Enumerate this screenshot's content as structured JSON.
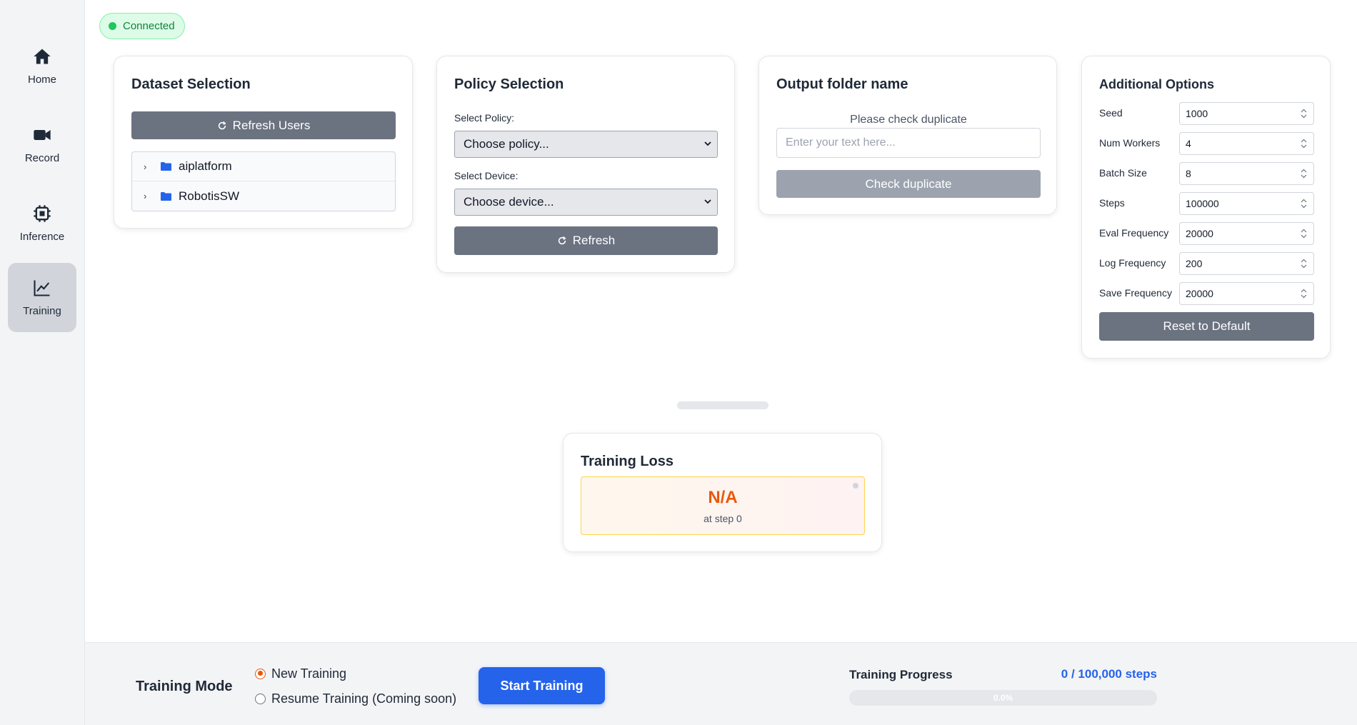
{
  "sidebar": {
    "items": [
      {
        "label": "Home",
        "icon": "home-icon"
      },
      {
        "label": "Record",
        "icon": "video-icon"
      },
      {
        "label": "Inference",
        "icon": "cpu-icon"
      },
      {
        "label": "Training",
        "icon": "chart-line-icon",
        "active": true
      }
    ]
  },
  "status": {
    "label": "Connected",
    "color": "#22c55e"
  },
  "dataset": {
    "title": "Dataset Selection",
    "refresh_label": "Refresh Users",
    "users": [
      "aiplatform",
      "RobotisSW"
    ]
  },
  "policy": {
    "title": "Policy Selection",
    "policy_label": "Select Policy:",
    "policy_value": "Choose policy...",
    "device_label": "Select Device:",
    "device_value": "Choose device...",
    "refresh_label": "Refresh"
  },
  "output": {
    "title": "Output folder name",
    "hint": "Please check duplicate",
    "placeholder": "Enter your text here...",
    "check_label": "Check duplicate"
  },
  "options": {
    "title": "Additional Options",
    "fields": [
      {
        "label": "Seed",
        "value": "1000"
      },
      {
        "label": "Num Workers",
        "value": "4"
      },
      {
        "label": "Batch Size",
        "value": "8"
      },
      {
        "label": "Steps",
        "value": "100000"
      },
      {
        "label": "Eval Frequency",
        "value": "20000"
      },
      {
        "label": "Log Frequency",
        "value": "200"
      },
      {
        "label": "Save Frequency",
        "value": "20000"
      }
    ],
    "reset_label": "Reset to Default"
  },
  "loss": {
    "title": "Training Loss",
    "value": "N/A",
    "step_text": "at step 0"
  },
  "bottom": {
    "mode_title": "Training Mode",
    "modes": [
      {
        "label": "New Training",
        "checked": true
      },
      {
        "label": "Resume Training (Coming soon)",
        "checked": false
      }
    ],
    "start_label": "Start Training",
    "progress_label": "Training Progress",
    "progress_steps": "0 / 100,000 steps",
    "progress_fraction": 0,
    "progress_pct": "0.0%"
  },
  "colors": {
    "accent": "#2563eb",
    "button_gray": "#6b7280",
    "loss_value": "#ea580c"
  }
}
